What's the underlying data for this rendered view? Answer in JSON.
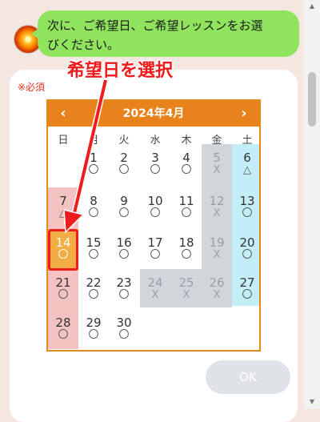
{
  "message": {
    "line1": "次に、ご希望日、ご希望レッスンをお選",
    "line2": "びください。"
  },
  "form": {
    "required_label": "※必須",
    "ok_label": "OK"
  },
  "annotation": {
    "text": "希望日を選択"
  },
  "calendar": {
    "title": "2024年4月",
    "prev_label": "‹",
    "next_label": "›",
    "weekdays": [
      "日",
      "月",
      "火",
      "水",
      "木",
      "金",
      "土"
    ],
    "weeks": [
      [
        null,
        {
          "d": "1",
          "s": "〇"
        },
        {
          "d": "2",
          "s": "〇"
        },
        {
          "d": "3",
          "s": "〇"
        },
        {
          "d": "4",
          "s": "〇"
        },
        {
          "d": "5",
          "s": "X",
          "dis": true
        },
        {
          "d": "6",
          "s": "△"
        }
      ],
      [
        {
          "d": "7",
          "s": "△"
        },
        {
          "d": "8",
          "s": "〇"
        },
        {
          "d": "9",
          "s": "〇"
        },
        {
          "d": "10",
          "s": "〇"
        },
        {
          "d": "11",
          "s": "〇"
        },
        {
          "d": "12",
          "s": "X",
          "dis": true
        },
        {
          "d": "13",
          "s": "〇"
        }
      ],
      [
        {
          "d": "14",
          "s": "〇",
          "sel": true
        },
        {
          "d": "15",
          "s": "〇"
        },
        {
          "d": "16",
          "s": "〇"
        },
        {
          "d": "17",
          "s": "〇"
        },
        {
          "d": "18",
          "s": "〇"
        },
        {
          "d": "19",
          "s": "X",
          "dis": true
        },
        {
          "d": "20",
          "s": "〇"
        }
      ],
      [
        {
          "d": "21",
          "s": "〇"
        },
        {
          "d": "22",
          "s": "〇"
        },
        {
          "d": "23",
          "s": "〇"
        },
        {
          "d": "24",
          "s": "X",
          "dis": true
        },
        {
          "d": "25",
          "s": "X",
          "dis": true
        },
        {
          "d": "26",
          "s": "X",
          "dis": true
        },
        {
          "d": "27",
          "s": "〇"
        }
      ],
      [
        {
          "d": "28",
          "s": "〇"
        },
        {
          "d": "29",
          "s": "〇"
        },
        {
          "d": "30",
          "s": "〇"
        },
        null,
        null,
        null,
        null
      ]
    ],
    "colors": {
      "header": "#e8821c",
      "sunday": "#f5c2c2",
      "saturday": "#c4eef7",
      "disabled": "#d2d5da",
      "selected": "#f1ad43"
    }
  }
}
